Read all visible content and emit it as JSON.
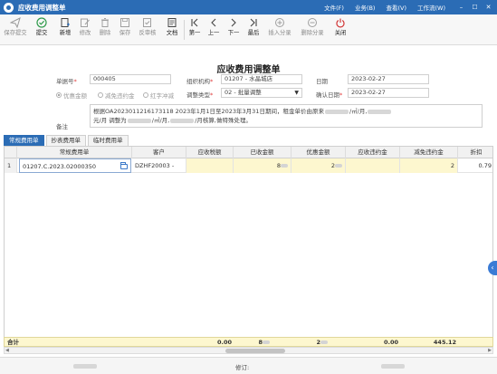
{
  "window": {
    "title": "应收费用调整单",
    "menus": [
      "文件(F)",
      "业务(B)",
      "查看(V)",
      "工作流(W)"
    ],
    "controls": [
      "–",
      "☐",
      "✕"
    ]
  },
  "toolbar": {
    "items": [
      {
        "key": "save_submit",
        "label": "保存提交",
        "icon": "send-icon"
      },
      {
        "key": "submit",
        "label": "提交",
        "icon": "check-circle-icon"
      },
      {
        "key": "new",
        "label": "新增",
        "icon": "new-doc-icon"
      },
      {
        "key": "modify",
        "label": "修改",
        "icon": "edit-icon"
      },
      {
        "key": "delete",
        "label": "删除",
        "icon": "trash-icon"
      },
      {
        "key": "save",
        "label": "保存",
        "icon": "save-icon"
      },
      {
        "key": "unapprove",
        "label": "反审核",
        "icon": "unapprove-icon"
      },
      {
        "key": "file",
        "label": "文档",
        "icon": "document-icon"
      },
      {
        "key": "first",
        "label": "第一",
        "icon": "first-icon"
      },
      {
        "key": "prev",
        "label": "上一",
        "icon": "prev-icon"
      },
      {
        "key": "next",
        "label": "下一",
        "icon": "next-icon"
      },
      {
        "key": "last",
        "label": "最后",
        "icon": "last-icon"
      },
      {
        "key": "insert_entry",
        "label": "插入分录",
        "icon": "insert-row-icon"
      },
      {
        "key": "delete_entry",
        "label": "删除分录",
        "icon": "delete-row-icon"
      },
      {
        "key": "close",
        "label": "关闭",
        "icon": "power-icon"
      }
    ]
  },
  "form": {
    "title": "应收费用调整单",
    "doc_no_label": "单据号",
    "doc_no": "000405",
    "org_label": "组织机构",
    "org": "01207 - 水晶城店",
    "date_label": "日期",
    "date": "2023-02-27",
    "radio_options": [
      "优惠金额",
      "减免违约金",
      "红字冲减"
    ],
    "adjust_type_label": "调整类型",
    "adjust_type": "02 - 批量调整",
    "confirm_date_label": "确认日期",
    "confirm_date": "2023-02-27",
    "remark_label": "备注",
    "remark_line1_a": "根据OA2023011216173118  2023年1月1日至2023年3月31日期间，租金单价由原来",
    "remark_line1_b": "/㎡/月,",
    "remark_line2_a": "元/月  调整为",
    "remark_line2_b": "/㎡/月,",
    "remark_line2_c": "/月核算,做特殊处理。"
  },
  "tabs": [
    "常规费用单",
    "抄表费用单",
    "临时费用单"
  ],
  "grid": {
    "columns": [
      "常规费用单",
      "客户",
      "应收税额",
      "已收金额",
      "优惠金额",
      "应收违约金",
      "减免违约金",
      "折扣"
    ],
    "rows": [
      {
        "index": "1",
        "bill": "01207.C.2023.02000350",
        "customer": "DZHF20003 -",
        "tax": "",
        "received": "8",
        "discount": "2",
        "penalty": "",
        "waived": "2",
        "rate": "0.79"
      }
    ],
    "totals": {
      "label": "合计",
      "tax": "0.00",
      "received": "8",
      "discount": "2",
      "penalty": "0.00",
      "waived": "445.12"
    }
  },
  "statusbar": {
    "modifier_label": "修订:"
  },
  "colors": {
    "titlebar": "#2b6cb5",
    "required": "#e03a3a",
    "editable_cell": "#fdf7cf"
  }
}
